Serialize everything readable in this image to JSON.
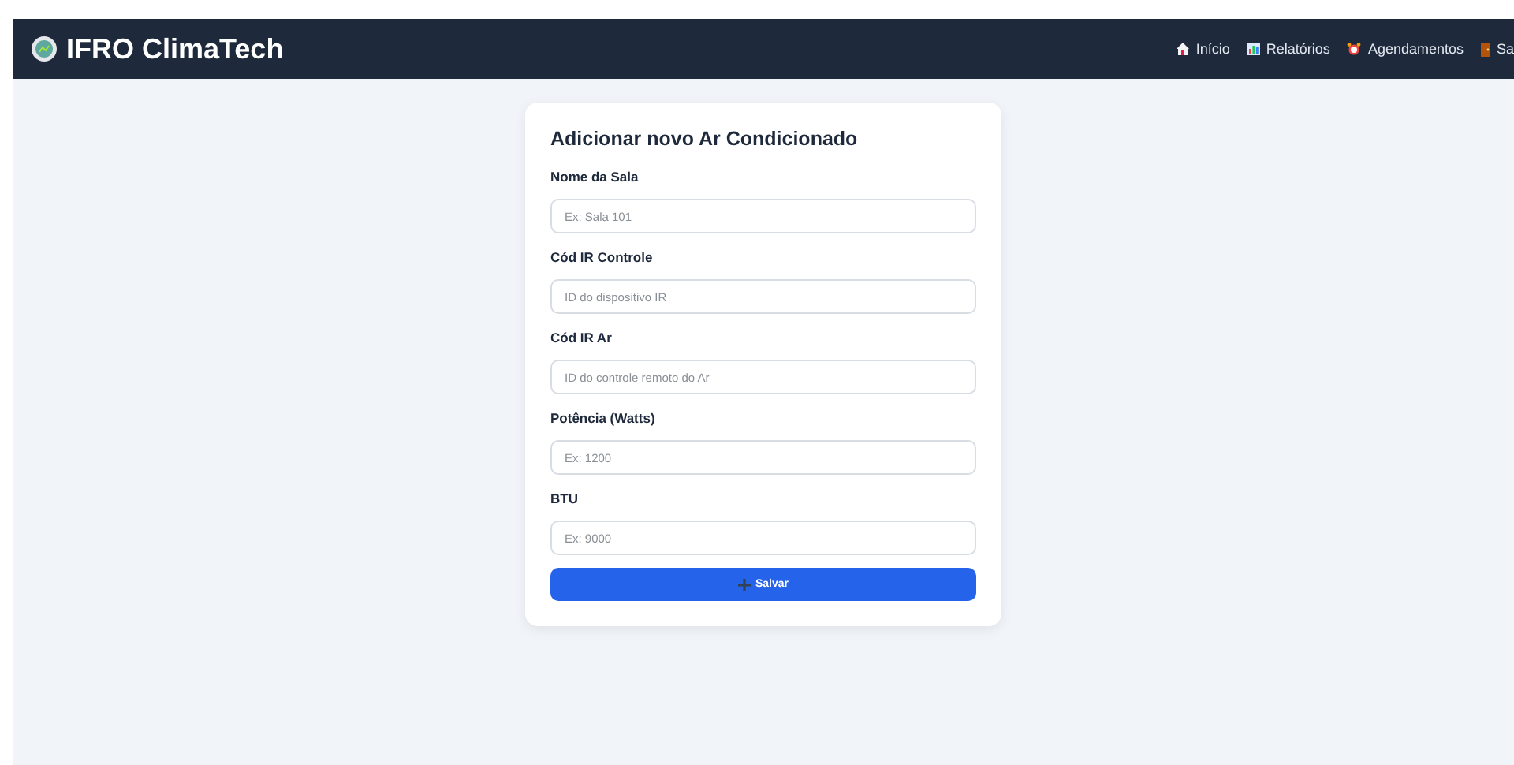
{
  "header": {
    "brand": "IFRO ClimaTech",
    "nav": [
      {
        "label": "Início",
        "kind": "home"
      },
      {
        "label": "Relatórios",
        "kind": "chart"
      },
      {
        "label": "Agendamentos",
        "kind": "alarm"
      },
      {
        "label": "Sa",
        "kind": "door"
      }
    ]
  },
  "form": {
    "title": "Adicionar novo Ar Condicionado",
    "fields": [
      {
        "label": "Nome da Sala",
        "placeholder": "Ex: Sala 101"
      },
      {
        "label": "Cód IR Controle",
        "placeholder": "ID do dispositivo IR"
      },
      {
        "label": "Cód IR Ar",
        "placeholder": "ID do controle remoto do Ar"
      },
      {
        "label": "Potência (Watts)",
        "placeholder": "Ex: 1200"
      },
      {
        "label": "BTU",
        "placeholder": "Ex: 9000"
      }
    ],
    "submit": "Salvar"
  }
}
